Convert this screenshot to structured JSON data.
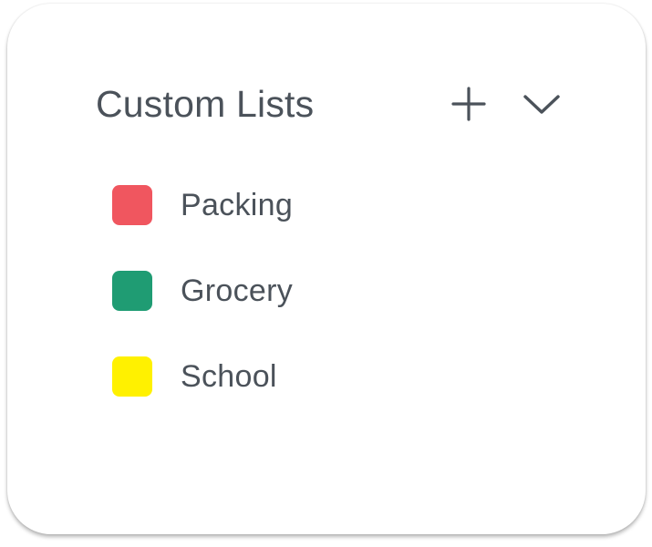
{
  "panel": {
    "title": "Custom Lists",
    "add_icon": "plus-icon",
    "collapse_icon": "chevron-down-icon"
  },
  "lists": [
    {
      "label": "Packing",
      "color": "#f0565f"
    },
    {
      "label": "Grocery",
      "color": "#1f9c73"
    },
    {
      "label": "School",
      "color": "#fff100"
    }
  ],
  "colors": {
    "text": "#4b525a",
    "icon": "#4b525a",
    "background": "#ffffff"
  }
}
